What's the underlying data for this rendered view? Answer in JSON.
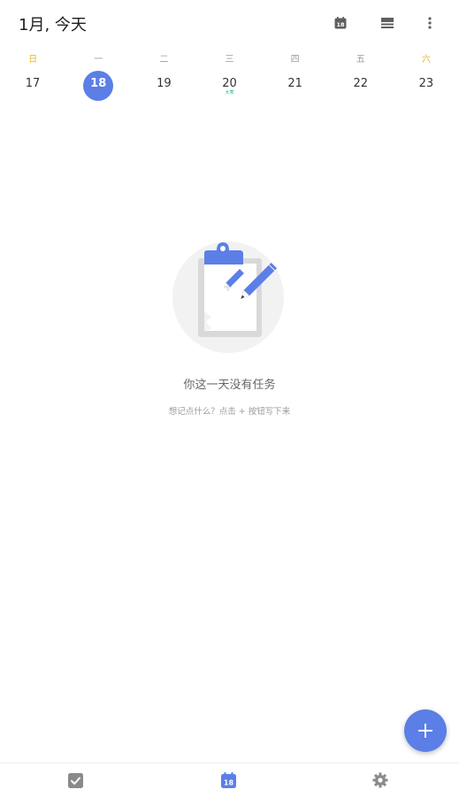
{
  "header": {
    "title": "1月, 今天",
    "calendar_icon_day": "18",
    "icons": [
      "calendar-icon",
      "list-view-icon",
      "more-vertical-icon"
    ]
  },
  "week": {
    "weekdays": [
      "日",
      "一",
      "二",
      "三",
      "四",
      "五",
      "六"
    ],
    "dates": [
      "17",
      "18",
      "19",
      "20",
      "21",
      "22",
      "23"
    ],
    "selected_index": 1,
    "holiday_label": "大寒",
    "holiday_index": 3
  },
  "empty_state": {
    "title": "你这一天没有任务",
    "subtitle": "想记点什么？点击 + 按钮写下来"
  },
  "fab": {
    "icon": "plus-icon"
  },
  "bottom_nav": {
    "items": [
      {
        "name": "tasks",
        "icon": "checkbox-icon"
      },
      {
        "name": "calendar",
        "icon": "calendar-icon",
        "day": "18",
        "active": true
      },
      {
        "name": "settings",
        "icon": "gear-icon"
      }
    ]
  },
  "colors": {
    "accent": "#5b7fe6",
    "weekend": "#f2b21b",
    "holiday": "#2bb673",
    "icon_gray": "#8a8a8a"
  }
}
